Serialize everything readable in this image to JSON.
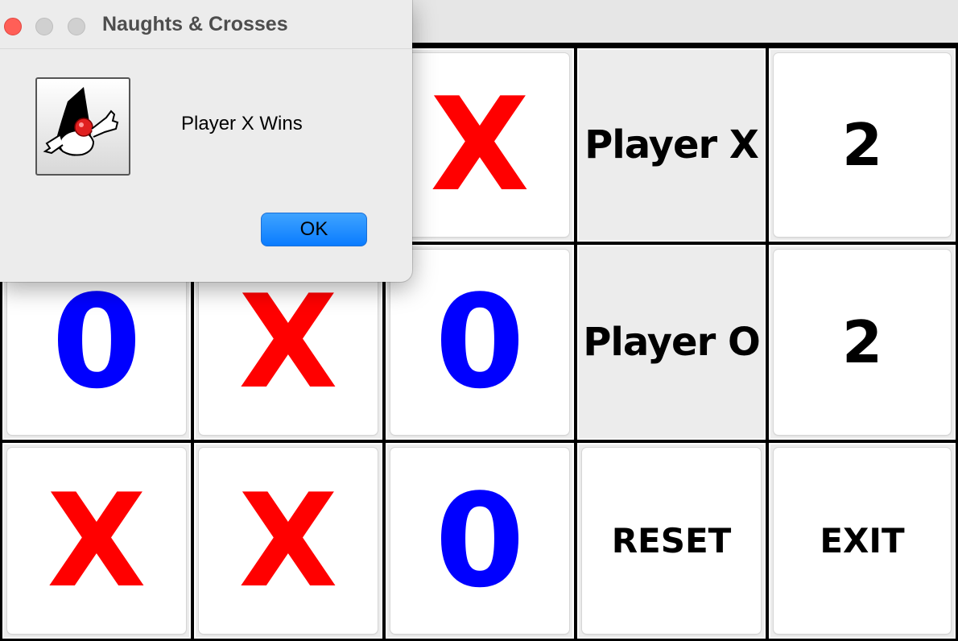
{
  "dialog": {
    "title": "Naughts & Crosses",
    "message": "Player X Wins",
    "ok_label": "OK",
    "icon": "java-duke-icon"
  },
  "board": {
    "cells": [
      "",
      "",
      "X",
      "0",
      "X",
      "0",
      "X",
      "X",
      "0"
    ]
  },
  "scoreboard": {
    "player_x_label": "Player X",
    "player_x_score": "2",
    "player_o_label": "Player O",
    "player_o_score": "2"
  },
  "controls": {
    "reset_label": "RESET",
    "exit_label": "EXIT"
  },
  "colors": {
    "x": "#ff0000",
    "o": "#0000ff",
    "ok_button": "#0a7cff",
    "close_button": "#ff5f57"
  }
}
